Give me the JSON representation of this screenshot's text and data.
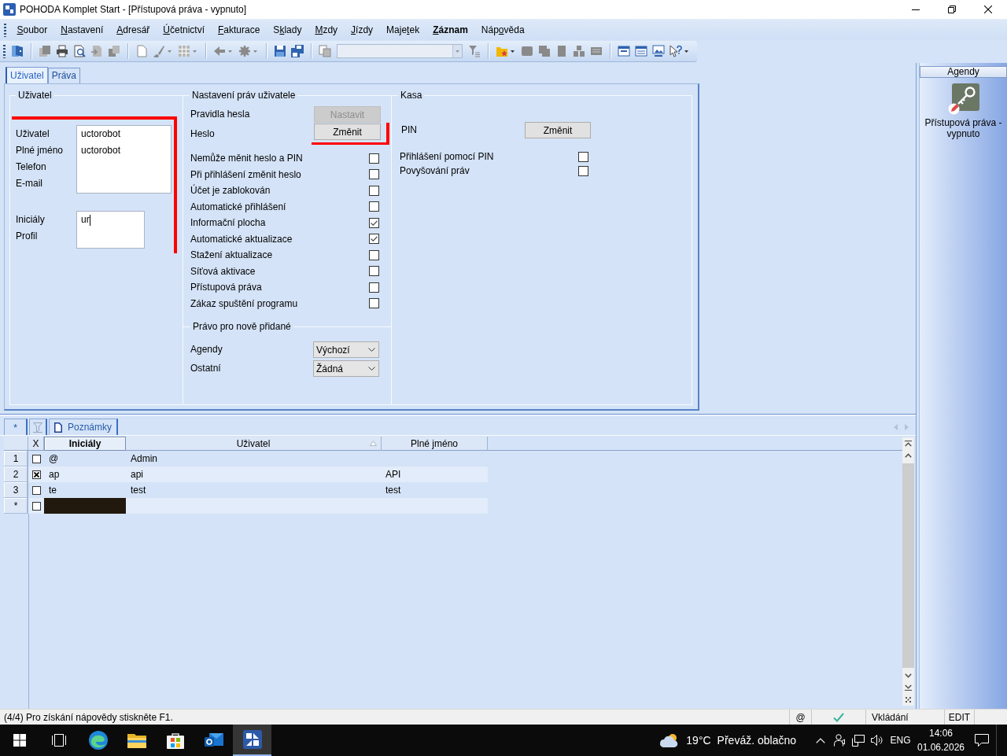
{
  "window": {
    "title": "POHODA Komplet Start - [Přístupová práva - vypnuto]"
  },
  "menu": [
    {
      "key": "S",
      "post": "oubor",
      "bold": false
    },
    {
      "key": "N",
      "post": "astavení",
      "bold": false
    },
    {
      "key": "A",
      "post": "dresář",
      "bold": false
    },
    {
      "key": "Ú",
      "post": "četnictví",
      "bold": false
    },
    {
      "key": "F",
      "post": "akturace",
      "bold": false
    },
    {
      "pre": "S",
      "key": "k",
      "post": "lady",
      "bold": false
    },
    {
      "key": "M",
      "post": "zdy",
      "bold": false
    },
    {
      "key": "J",
      "post": "ízdy",
      "bold": false
    },
    {
      "pre": "Maje",
      "key": "t",
      "post": "ek",
      "bold": false
    },
    {
      "key": "Z",
      "post": "áznam",
      "bold": true
    },
    {
      "pre": "Náp",
      "key": "o",
      "post": "věda",
      "bold": false
    }
  ],
  "toolbar": [
    {
      "kind": "button",
      "disabled": false
    },
    {
      "kind": "separator"
    },
    {
      "kind": "button",
      "disabled": true
    },
    {
      "kind": "button",
      "disabled": false
    },
    {
      "kind": "button",
      "disabled": false
    },
    {
      "kind": "button",
      "disabled": true
    },
    {
      "kind": "button",
      "disabled": true
    },
    {
      "kind": "separator"
    },
    {
      "kind": "button",
      "disabled": true
    },
    {
      "kind": "button",
      "disabled": true,
      "dropdown": true
    },
    {
      "kind": "button",
      "disabled": true,
      "dropdown": true
    },
    {
      "kind": "separator"
    },
    {
      "kind": "button",
      "disabled": true,
      "dropdown": true
    },
    {
      "kind": "button",
      "disabled": true,
      "dropdown": true
    },
    {
      "kind": "separator"
    },
    {
      "kind": "button",
      "disabled": false
    },
    {
      "kind": "button",
      "disabled": false
    },
    {
      "kind": "separator"
    },
    {
      "kind": "button",
      "disabled": true
    },
    {
      "kind": "combo",
      "disabled": true
    },
    {
      "kind": "button",
      "disabled": true
    },
    {
      "kind": "separator"
    },
    {
      "kind": "button",
      "disabled": false,
      "dropdown": true
    },
    {
      "kind": "button",
      "disabled": true
    },
    {
      "kind": "button",
      "disabled": true
    },
    {
      "kind": "button",
      "disabled": true
    },
    {
      "kind": "button",
      "disabled": true
    },
    {
      "kind": "button",
      "disabled": true
    },
    {
      "kind": "separator"
    },
    {
      "kind": "button",
      "disabled": false
    },
    {
      "kind": "button",
      "disabled": false
    },
    {
      "kind": "button",
      "disabled": false
    },
    {
      "kind": "button",
      "disabled": false,
      "dropdown": true
    }
  ],
  "tabs": [
    {
      "label": "Uživatel",
      "selected": true
    },
    {
      "label": "Práva",
      "selected": false
    }
  ],
  "user_group": {
    "title": "Uživatel",
    "marked": true,
    "fields": [
      {
        "label": "Uživatel",
        "value": "uctorobot",
        "focused": false
      },
      {
        "label": "Plné jméno",
        "value": "uctorobot",
        "focused": false
      },
      {
        "label": "Telefon",
        "focused": false
      },
      {
        "label": "E-mail",
        "focused": false
      }
    ],
    "fields_2": [
      {
        "label": "Iniciály",
        "value": "ur",
        "focused": true
      },
      {
        "label": "Profil",
        "focused": false
      }
    ]
  },
  "rights_group": {
    "title": "Nastavení práv uživatele",
    "actions": [
      {
        "label": "Pravidla hesla",
        "button": "Nastavit",
        "disabled": true
      },
      {
        "label": "Heslo",
        "button": "Změnit",
        "disabled": false,
        "marked": true
      }
    ],
    "options": [
      {
        "label": "Nemůže měnit heslo a PIN",
        "checked": false
      },
      {
        "label": "Při přihlášení změnit heslo",
        "checked": false
      },
      {
        "label": "Účet je zablokován",
        "checked": false
      },
      {
        "label": "Automatické přihlášení",
        "checked": false
      },
      {
        "label": "Informační plocha",
        "checked": true
      },
      {
        "label": "Automatické aktualizace",
        "checked": true
      },
      {
        "label": "Stažení aktualizace",
        "checked": false
      },
      {
        "label": "Síťová aktivace",
        "checked": false
      },
      {
        "label": "Přístupová práva",
        "checked": false
      },
      {
        "label": "Zákaz spuštění programu",
        "checked": false
      }
    ],
    "new_items": {
      "title": "Právo pro nově přidané",
      "fields": [
        {
          "label": "Agendy",
          "value": "Výchozí"
        },
        {
          "label": "Ostatní",
          "value": "Žádná"
        }
      ]
    }
  },
  "cash_group": {
    "title": "Kasa",
    "pin": {
      "label": "PIN",
      "button": "Změnit"
    },
    "options": [
      {
        "label": "Přihlášení pomocí PIN",
        "checked": false
      },
      {
        "label": "Povyšování práv",
        "checked": false
      }
    ]
  },
  "agendy": {
    "title": "Agendy",
    "items": [
      {
        "label": "Přístupová práva - vypnuto",
        "selected": false
      }
    ]
  },
  "records": {
    "tabs": [
      {
        "kind": "new",
        "label": "*",
        "disabled": false
      },
      {
        "kind": "filter",
        "disabled": true
      },
      {
        "kind": "notes",
        "label": "Poznámky",
        "disabled": false
      }
    ],
    "columns": [
      {
        "label": "X",
        "selected": false,
        "sorted": false
      },
      {
        "label": "Iniciály",
        "selected": true,
        "sorted": false
      },
      {
        "label": "Uživatel",
        "selected": false,
        "sorted": true
      },
      {
        "label": "Plné jméno",
        "selected": false,
        "sorted": false
      }
    ],
    "rows": [
      {
        "number": "1",
        "checked": false,
        "initials": "@",
        "user": "Admin",
        "selected": false
      },
      {
        "number": "2",
        "checked": true,
        "initials": "ap",
        "user": "api",
        "full_name": "API",
        "selected": false
      },
      {
        "number": "3",
        "checked": false,
        "initials": "te",
        "user": "test",
        "full_name": "test",
        "selected": false
      },
      {
        "number": "*",
        "checked": false,
        "selected": true
      }
    ]
  },
  "status_bar": {
    "text": "(4/4) Pro získání nápovědy stiskněte F1.",
    "panels": [
      {
        "kind": "text",
        "text": "@"
      },
      {
        "kind": "check"
      },
      {
        "kind": "text",
        "text": "Vkládání"
      },
      {
        "kind": "text",
        "text": "EDIT"
      }
    ]
  },
  "taskbar": {
    "apps": [
      {
        "selected": false
      },
      {
        "selected": false
      },
      {
        "selected": false
      },
      {
        "selected": false
      },
      {
        "selected": true
      }
    ],
    "weather": {
      "temperature": "19°C",
      "summary": "Převáž. oblačno"
    },
    "language": "ENG",
    "time": "14:06",
    "date": "01.06.2026"
  }
}
